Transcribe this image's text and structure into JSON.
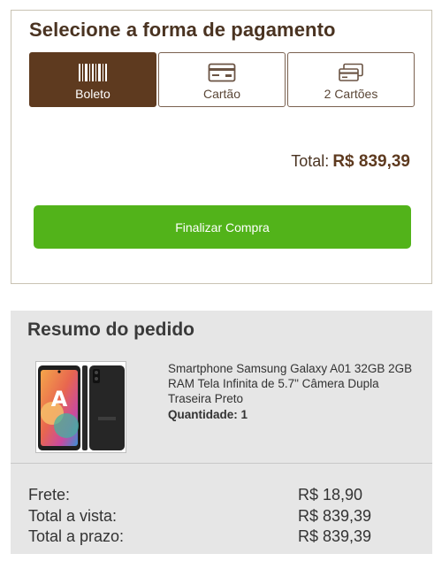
{
  "payment": {
    "title": "Selecione a forma de pagamento",
    "methods": [
      {
        "label": "Boleto",
        "icon": "barcode-icon",
        "selected": true
      },
      {
        "label": "Cartão",
        "icon": "credit-card-icon",
        "selected": false
      },
      {
        "label": "2 Cartões",
        "icon": "two-cards-icon",
        "selected": false
      }
    ],
    "total_label": "Total:",
    "total_value": "R$ 839,39",
    "finish_label": "Finalizar Compra"
  },
  "summary": {
    "title": "Resumo do pedido",
    "product": {
      "description": "Smartphone Samsung Galaxy A01 32GB 2GB RAM Tela Infinita de 5.7\" Câmera Dupla Traseira Preto",
      "quantity": "Quantidade: 1"
    },
    "rows": [
      {
        "label": "Frete:",
        "value": "R$ 18,90"
      },
      {
        "label": "Total a vista:",
        "value": "R$ 839,39"
      },
      {
        "label": "Total a prazo:",
        "value": "R$ 839,39"
      }
    ]
  },
  "colors": {
    "brand_brown": "#5e3a1f",
    "action_green": "#52b31a",
    "summary_bg": "#e6e6e6"
  }
}
